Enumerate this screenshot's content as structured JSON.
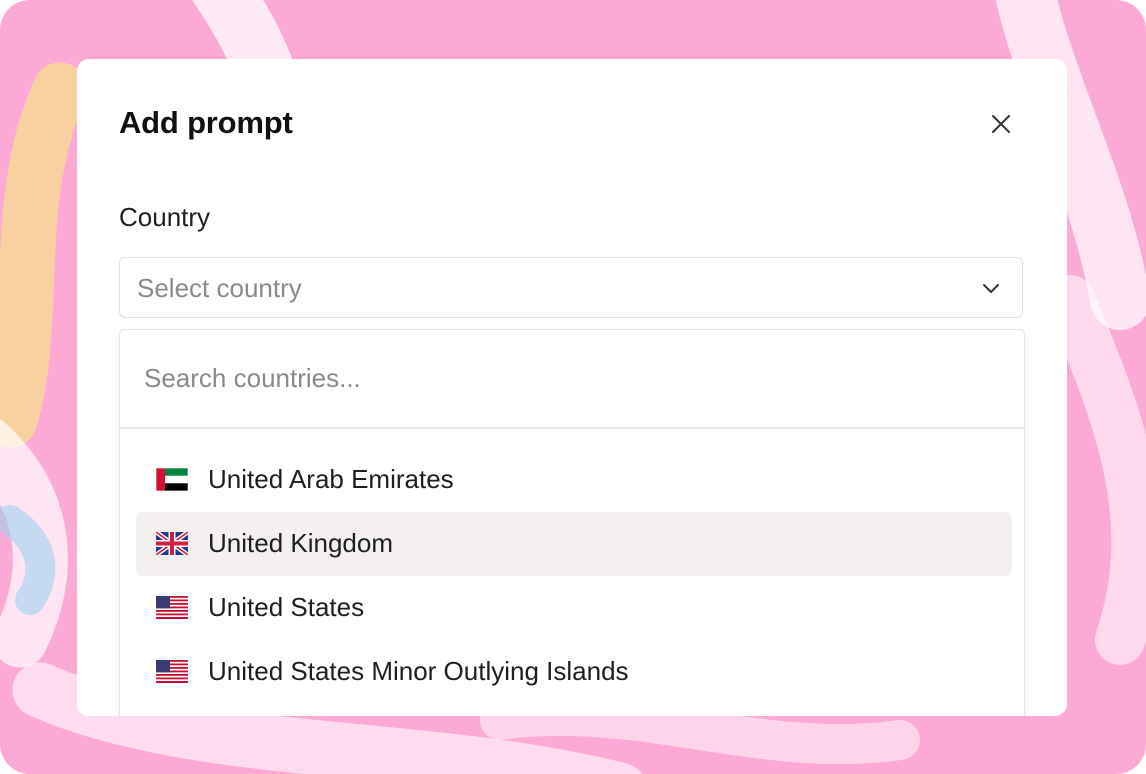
{
  "dialog": {
    "title": "Add prompt",
    "close_icon": "close-icon"
  },
  "country_field": {
    "label": "Country",
    "placeholder": "Select country",
    "chevron_icon": "chevron-down-icon"
  },
  "dropdown": {
    "search_placeholder": "Search countries...",
    "search_value": "",
    "highlighted_index": 1,
    "options": [
      {
        "label": "United Arab Emirates",
        "flag": "flag-uae-icon"
      },
      {
        "label": "United Kingdom",
        "flag": "flag-uk-icon"
      },
      {
        "label": "United States",
        "flag": "flag-us-icon"
      },
      {
        "label": "United States Minor Outlying Islands",
        "flag": "flag-us-icon"
      }
    ]
  },
  "colors": {
    "backdrop": "#fda9d6",
    "modal_background": "#ffffff",
    "highlight": "#f3f0ef",
    "text_primary": "#1f1f1f",
    "text_placeholder": "#8a8a8a"
  }
}
